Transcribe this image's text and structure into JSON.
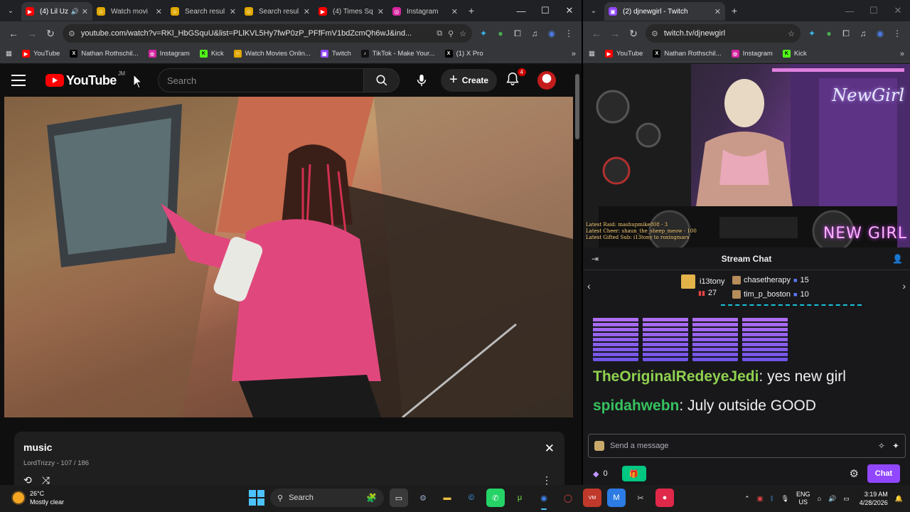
{
  "left_browser": {
    "tabs": [
      {
        "title": "(4) Lil Uz",
        "favicon": "youtube-icon",
        "color": "#ff0000",
        "active": true
      },
      {
        "title": "Watch movi",
        "favicon": "movie-site-icon",
        "color": "#e0a800"
      },
      {
        "title": "Search resul",
        "favicon": "search-site-icon",
        "color": "#e0a800"
      },
      {
        "title": "Search resul",
        "favicon": "search-site-icon",
        "color": "#e0a800"
      },
      {
        "title": "(4) Times Sq",
        "favicon": "youtube-icon",
        "color": "#ff0000"
      },
      {
        "title": "Instagram",
        "favicon": "instagram-icon",
        "color": "#d6249f"
      }
    ],
    "new_tab": "+",
    "url": "youtube.com/watch?v=RKl_HbGSquU&list=PLlKVL5Hy7fwP0zP_PFfFmV1bdZcmQh6wJ&ind...",
    "bookmarks": [
      {
        "label": "YouTube",
        "icon": "youtube-icon",
        "color": "#ff0000"
      },
      {
        "label": "Nathan Rothschil...",
        "icon": "x-icon",
        "color": "#000000"
      },
      {
        "label": "Instagram",
        "icon": "instagram-icon",
        "color": "#d6249f"
      },
      {
        "label": "Kick",
        "icon": "kick-icon",
        "color": "#53fc18"
      },
      {
        "label": "Watch Movies Onlin...",
        "icon": "movie-site-icon",
        "color": "#e0a800"
      },
      {
        "label": "Twitch",
        "icon": "twitch-icon",
        "color": "#9147ff"
      },
      {
        "label": "TikTok - Make Your...",
        "icon": "tiktok-icon",
        "color": "#111111"
      },
      {
        "label": "(1) X Pro",
        "icon": "x-icon",
        "color": "#000000"
      }
    ]
  },
  "youtube": {
    "logo_text": "YouTube",
    "country": "JM",
    "search_placeholder": "Search",
    "create_label": "Create",
    "notification_count": "4",
    "playlist": {
      "title": "music",
      "subtitle": "LordTrizzy - 107 / 186"
    }
  },
  "right_browser": {
    "tab_title": "(2) djnewgirl - Twitch",
    "url": "twitch.tv/djnewgirl",
    "bookmarks": [
      {
        "label": "YouTube",
        "icon": "youtube-icon",
        "color": "#ff0000"
      },
      {
        "label": "Nathan Rothschil...",
        "icon": "x-icon",
        "color": "#000000"
      },
      {
        "label": "Instagram",
        "icon": "instagram-icon",
        "color": "#d6249f"
      },
      {
        "label": "Kick",
        "icon": "kick-icon",
        "color": "#53fc18"
      }
    ]
  },
  "twitch": {
    "overlay_lines": [
      "Latest Raid: mashupmike808 - 3",
      "Latest Cheer: shaun_the_sheep_meow - 100",
      "Latest Gifted Sub: i13tony to roxingmars"
    ],
    "brand_text_top": "NewGirl",
    "brand_text_bottom": "NEW GIRL",
    "chat_title": "Stream Chat",
    "gifters": [
      {
        "name": "i13tony",
        "count": "27"
      },
      {
        "name": "chasetherapy",
        "count": "15"
      },
      {
        "name": "tim_p_boston",
        "count": "10"
      }
    ],
    "messages": [
      {
        "user": "TheOriginalRedeyeJedi",
        "color": "#8fd14f",
        "text": "yes new girl"
      },
      {
        "user": "spidahwebn",
        "color": "#36c15f",
        "text": "July outside GOOD"
      }
    ],
    "input_placeholder": "Send a message",
    "points": "0",
    "chat_button": "Chat",
    "accent": "#9147ff"
  },
  "taskbar": {
    "temperature": "26°C",
    "weather": "Mostly clear",
    "search_label": "Search",
    "lang_top": "ENG",
    "lang_bottom": "US",
    "time": "3:19 AM",
    "date": "4/28/2026"
  }
}
